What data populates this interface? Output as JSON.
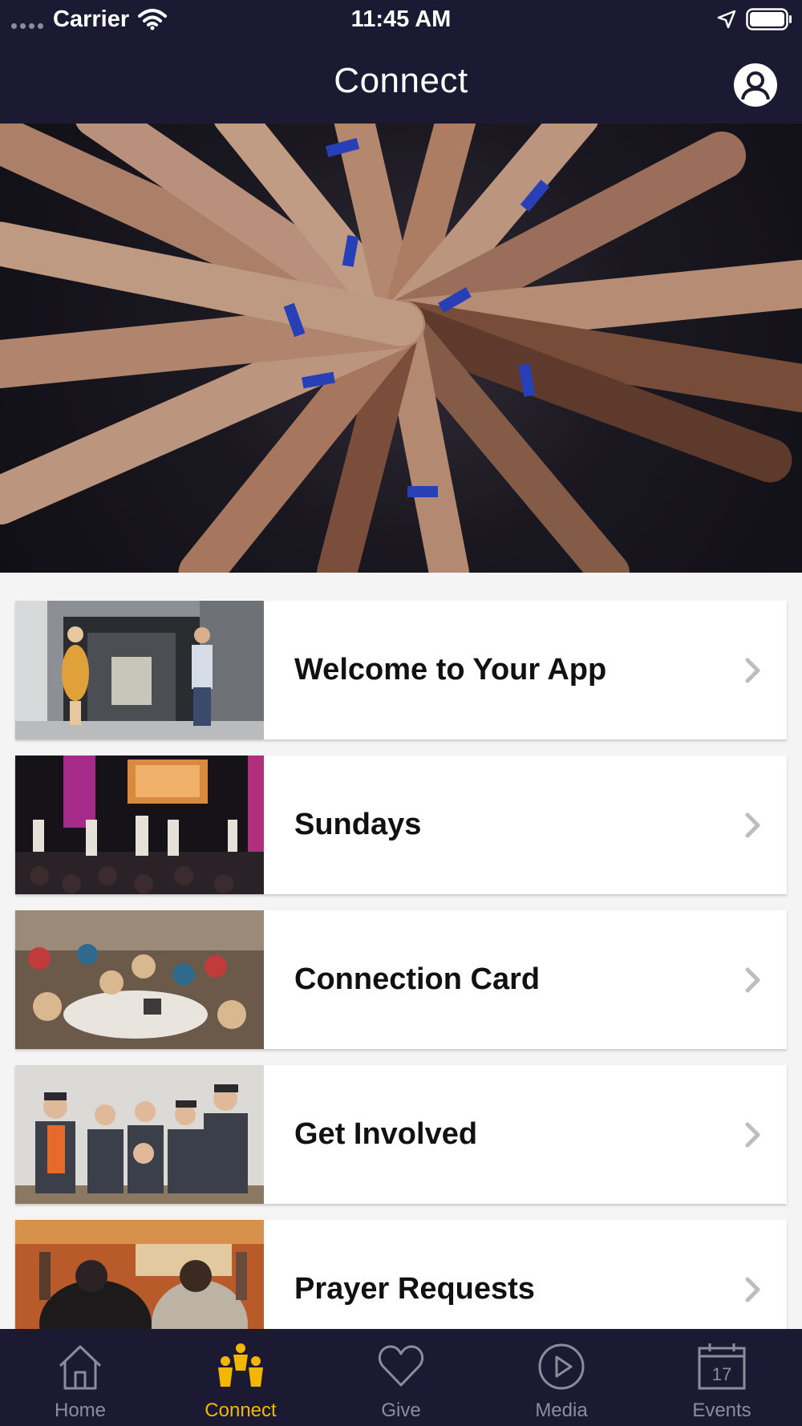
{
  "status_bar": {
    "carrier": "Carrier",
    "time": "11:45 AM"
  },
  "nav": {
    "title": "Connect"
  },
  "items": [
    {
      "label": "Welcome to Your App"
    },
    {
      "label": "Sundays"
    },
    {
      "label": "Connection Card"
    },
    {
      "label": "Get Involved"
    },
    {
      "label": "Prayer Requests"
    }
  ],
  "tabs": [
    {
      "label": "Home",
      "icon": "home-icon"
    },
    {
      "label": "Connect",
      "icon": "people-icon"
    },
    {
      "label": "Give",
      "icon": "heart-icon"
    },
    {
      "label": "Media",
      "icon": "play-icon"
    },
    {
      "label": "Events",
      "icon": "calendar-icon",
      "calendar_day": "17"
    }
  ],
  "colors": {
    "header": "#1c1a33",
    "active_tab": "#f2b705",
    "inactive_tab": "#8e8c9c"
  }
}
